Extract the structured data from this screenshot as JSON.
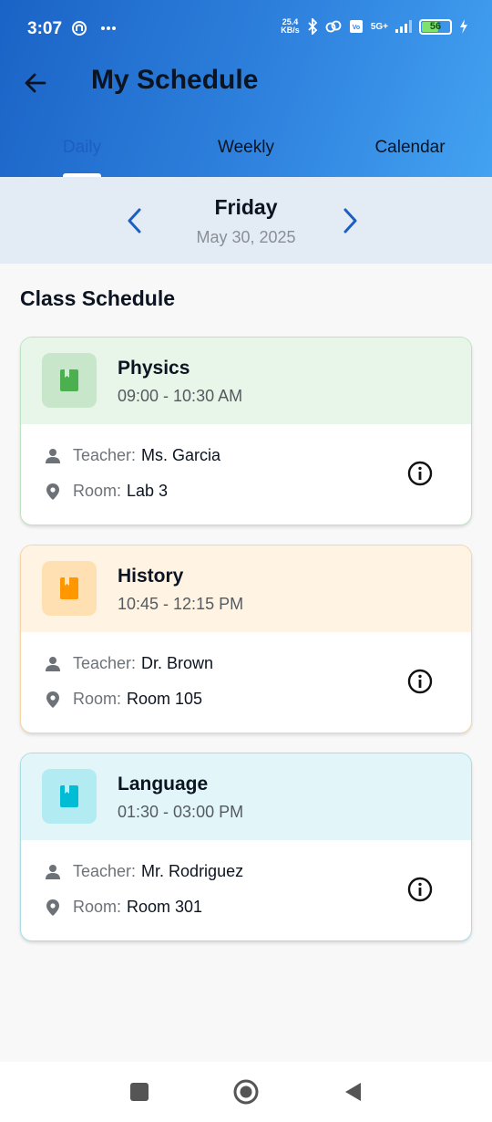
{
  "status_bar": {
    "time": "3:07",
    "network_speed_value": "25.4",
    "network_speed_unit": "KB/s",
    "network_type": "5G+",
    "battery_level": "56"
  },
  "header": {
    "title": "My Schedule",
    "tabs": [
      {
        "label": "Daily",
        "active": true
      },
      {
        "label": "Weekly",
        "active": false
      },
      {
        "label": "Calendar",
        "active": false
      }
    ]
  },
  "date_nav": {
    "day": "Friday",
    "date": "May 30, 2025"
  },
  "section_title": "Class Schedule",
  "labels": {
    "teacher": "Teacher:",
    "room": "Room:"
  },
  "classes": [
    {
      "subject": "Physics",
      "time": "09:00 - 10:30 AM",
      "teacher": "Ms. Garcia",
      "room": "Lab 3",
      "accent": "#4caf50",
      "tint": "#e8f5e9",
      "iconbox": "#c8e6c9",
      "border": "#bfe3c1"
    },
    {
      "subject": "History",
      "time": "10:45 - 12:15 PM",
      "teacher": "Dr. Brown",
      "room": "Room 105",
      "accent": "#ff9800",
      "tint": "#fff3e3",
      "iconbox": "#ffe0b2",
      "border": "#f6d6a9"
    },
    {
      "subject": "Language",
      "time": "01:30 - 03:00 PM",
      "teacher": "Mr. Rodriguez",
      "room": "Room 301",
      "accent": "#00bcd4",
      "tint": "#e2f6fa",
      "iconbox": "#b2ebf2",
      "border": "#a9dde6"
    }
  ],
  "icons": {
    "back": "arrow-left-icon",
    "prev": "chevron-left-icon",
    "next": "chevron-right-icon",
    "subject": "book-icon",
    "teacher": "person-icon",
    "room": "location-pin-icon",
    "info": "info-icon"
  },
  "colors": {
    "primary": "#1d5fc0",
    "header_start": "#1a63c6",
    "header_end": "#43a2f1",
    "date_bar": "#e3ebf5"
  }
}
